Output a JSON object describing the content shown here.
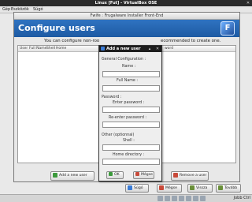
{
  "host": {
    "title": "Linux [Fut] - VirtualBox OSE",
    "menu": [
      "Gép",
      "Eszközök",
      "Súgó"
    ],
    "host_key": "Jobb Ctrl"
  },
  "installer": {
    "window_title": "Fwife : Frugalware Installer Front-End",
    "heading": "Configure users",
    "logo_letter": "F",
    "description_left": "You can configure non-roo",
    "description_right": "ecommended to create one.",
    "columns": [
      "User",
      "Full Name",
      "Shell",
      "Home",
      "word"
    ],
    "add_user_label": "Add a new user",
    "remove_user_label": "Remove a user"
  },
  "dialog": {
    "title": "Add a new user",
    "section_general": "General Configuration :",
    "name_label": "Name :",
    "name_value": "",
    "fullname_label": "Full Name :",
    "fullname_value": "",
    "password_section": "Password :",
    "password_label": "Enter password :",
    "password_value": "",
    "repassword_label": "Re-enter password :",
    "repassword_value": "",
    "other_section": "Other (optionnal)",
    "shell_label": "Shell :",
    "shell_value": "",
    "home_label": "Home directory :",
    "home_value": "",
    "ok_label": "OK",
    "cancel_label": "Mégse"
  },
  "nav": {
    "help_label": "Súgó",
    "cancel_label": "Mégse",
    "back_label": "Vissza",
    "next_label": "Tovább"
  },
  "colors": {
    "header_blue": "#1d5aa3",
    "dialog_titlebar": "#1d1d1d"
  }
}
